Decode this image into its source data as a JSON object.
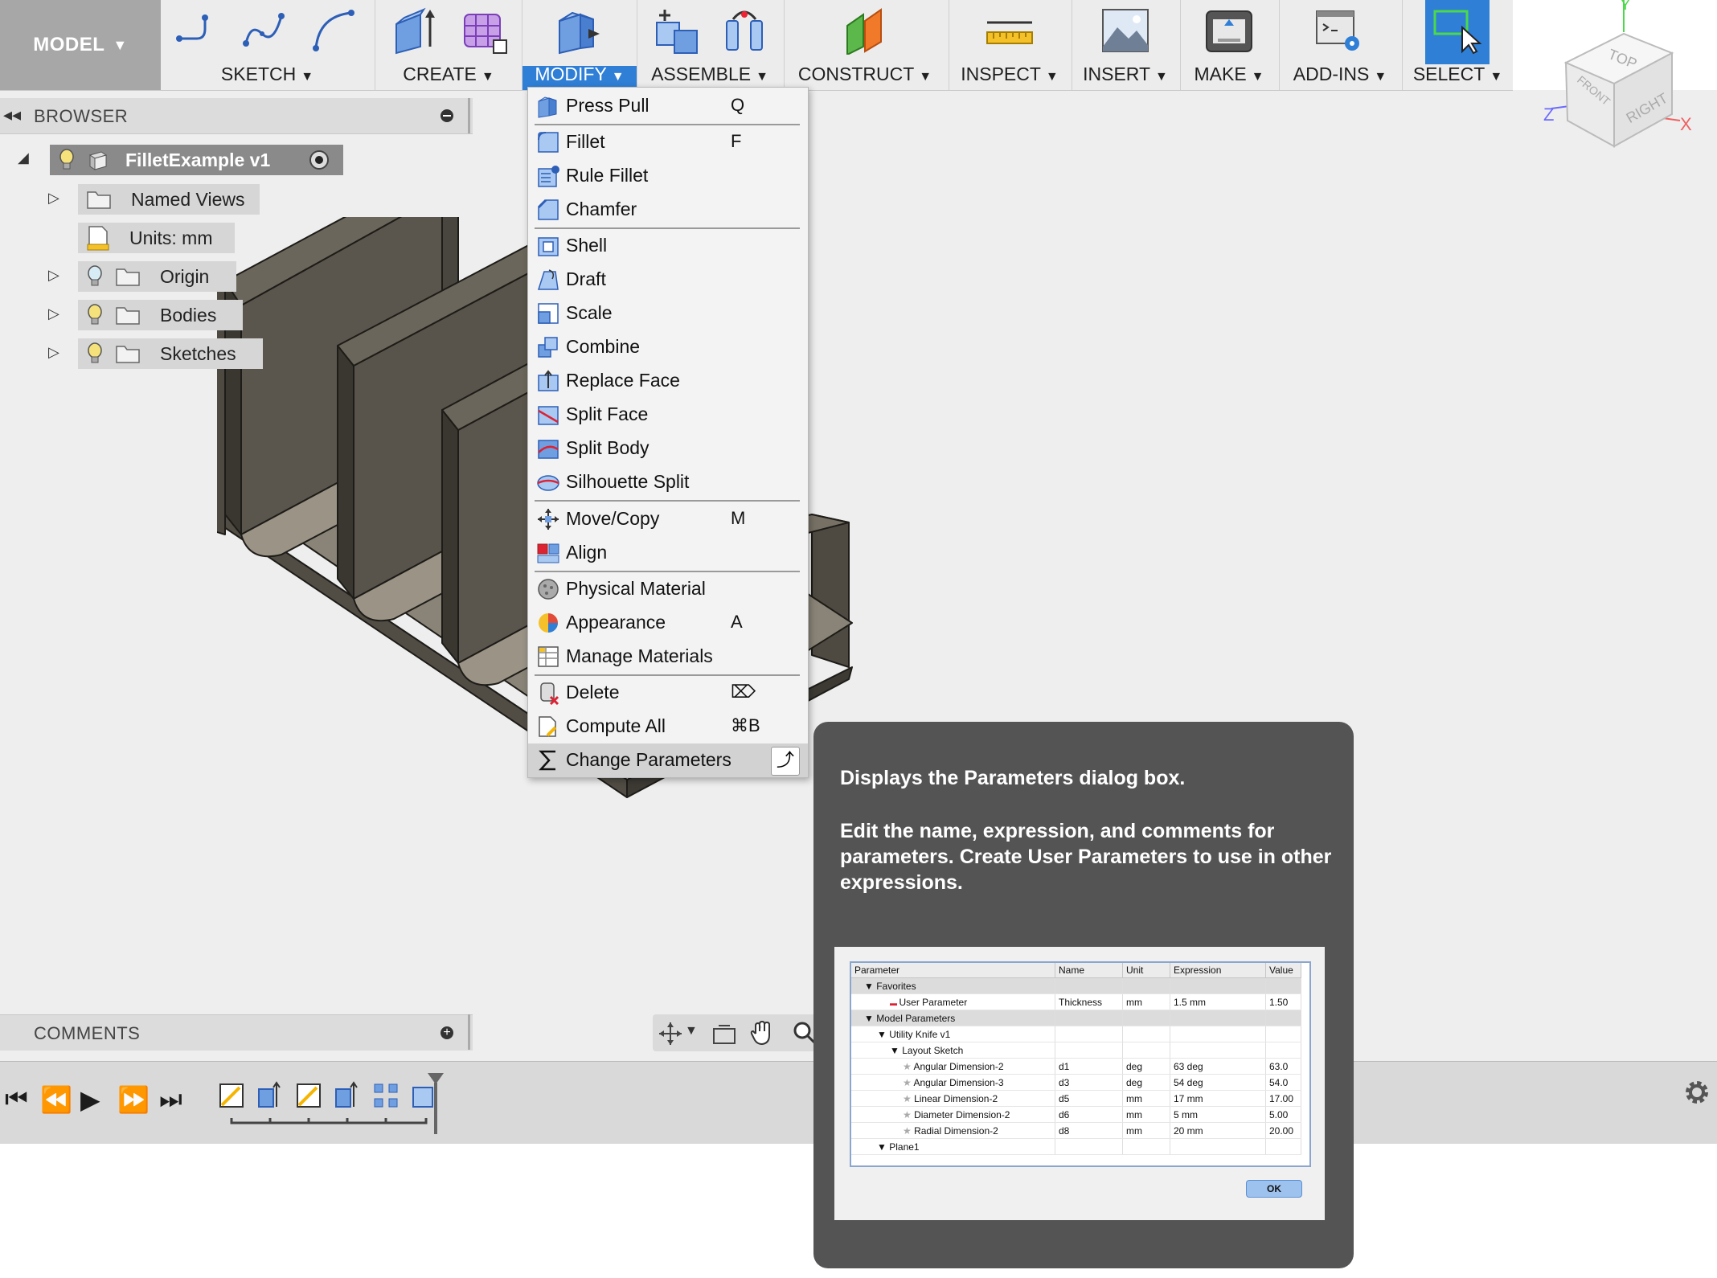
{
  "toolbar": {
    "workspace": "MODEL",
    "groups": [
      {
        "label": "SKETCH"
      },
      {
        "label": "CREATE"
      },
      {
        "label": "MODIFY"
      },
      {
        "label": "ASSEMBLE"
      },
      {
        "label": "CONSTRUCT"
      },
      {
        "label": "INSPECT"
      },
      {
        "label": "INSERT"
      },
      {
        "label": "MAKE"
      },
      {
        "label": "ADD-INS"
      },
      {
        "label": "SELECT"
      }
    ]
  },
  "viewcube": {
    "top": "TOP",
    "front": "FRONT",
    "right": "RIGHT",
    "axis_x": "X",
    "axis_y": "Y",
    "axis_z": "Z"
  },
  "browser": {
    "title": "BROWSER",
    "root": "FilletExample v1",
    "items": [
      {
        "label": "Named Views"
      },
      {
        "label": "Units: mm"
      },
      {
        "label": "Origin"
      },
      {
        "label": "Bodies"
      },
      {
        "label": "Sketches"
      }
    ]
  },
  "comments": {
    "title": "COMMENTS"
  },
  "modify_menu": {
    "items": [
      {
        "label": "Press Pull",
        "shortcut": "Q",
        "icon": "press-pull-icon"
      },
      {
        "label": "Fillet",
        "shortcut": "F",
        "icon": "fillet-icon"
      },
      {
        "label": "Rule Fillet",
        "shortcut": "",
        "icon": "rule-fillet-icon"
      },
      {
        "label": "Chamfer",
        "shortcut": "",
        "icon": "chamfer-icon"
      },
      {
        "label": "Shell",
        "shortcut": "",
        "icon": "shell-icon"
      },
      {
        "label": "Draft",
        "shortcut": "",
        "icon": "draft-icon"
      },
      {
        "label": "Scale",
        "shortcut": "",
        "icon": "scale-icon"
      },
      {
        "label": "Combine",
        "shortcut": "",
        "icon": "combine-icon"
      },
      {
        "label": "Replace Face",
        "shortcut": "",
        "icon": "replace-face-icon"
      },
      {
        "label": "Split Face",
        "shortcut": "",
        "icon": "split-face-icon"
      },
      {
        "label": "Split Body",
        "shortcut": "",
        "icon": "split-body-icon"
      },
      {
        "label": "Silhouette Split",
        "shortcut": "",
        "icon": "silhouette-split-icon"
      },
      {
        "label": "Move/Copy",
        "shortcut": "M",
        "icon": "move-copy-icon"
      },
      {
        "label": "Align",
        "shortcut": "",
        "icon": "align-icon"
      },
      {
        "label": "Physical Material",
        "shortcut": "",
        "icon": "physical-material-icon"
      },
      {
        "label": "Appearance",
        "shortcut": "A",
        "icon": "appearance-icon"
      },
      {
        "label": "Manage Materials",
        "shortcut": "",
        "icon": "manage-materials-icon"
      },
      {
        "label": "Delete",
        "shortcut": "⌦",
        "icon": "delete-icon"
      },
      {
        "label": "Compute All",
        "shortcut": "⌘B",
        "icon": "compute-all-icon"
      },
      {
        "label": "Change Parameters",
        "shortcut": "",
        "icon": "sigma-icon"
      }
    ]
  },
  "tooltip": {
    "line1": "Displays the Parameters dialog box.",
    "line2": "Edit the name, expression, and comments for parameters. Create User Parameters to use in other expressions.",
    "preview": {
      "headers": [
        "Parameter",
        "Name",
        "Unit",
        "Expression",
        "Value"
      ],
      "rows": [
        {
          "param": "Favorites",
          "name": "",
          "unit": "",
          "expr": "",
          "value": ""
        },
        {
          "param": "User Parameter",
          "name": "Thickness",
          "unit": "mm",
          "expr": "1.5 mm",
          "value": "1.50"
        },
        {
          "param": "Model Parameters",
          "name": "",
          "unit": "",
          "expr": "",
          "value": ""
        },
        {
          "param": "Utility Knife v1",
          "name": "",
          "unit": "",
          "expr": "",
          "value": ""
        },
        {
          "param": "Layout Sketch",
          "name": "",
          "unit": "",
          "expr": "",
          "value": ""
        },
        {
          "param": "Angular Dimension-2",
          "name": "d1",
          "unit": "deg",
          "expr": "63 deg",
          "value": "63.0"
        },
        {
          "param": "Angular Dimension-3",
          "name": "d3",
          "unit": "deg",
          "expr": "54 deg",
          "value": "54.0"
        },
        {
          "param": "Linear Dimension-2",
          "name": "d5",
          "unit": "mm",
          "expr": "17 mm",
          "value": "17.00"
        },
        {
          "param": "Diameter Dimension-2",
          "name": "d6",
          "unit": "mm",
          "expr": "5 mm",
          "value": "5.00"
        },
        {
          "param": "Radial Dimension-2",
          "name": "d8",
          "unit": "mm",
          "expr": "20 mm",
          "value": "20.00"
        },
        {
          "param": "Plane1",
          "name": "",
          "unit": "",
          "expr": "",
          "value": ""
        }
      ],
      "ok": "OK"
    }
  },
  "colors": {
    "accent": "#2f7fd7",
    "toolbar_bg": "#ececec",
    "tooltip_bg": "#545454",
    "model_body": "#5f5a50"
  }
}
